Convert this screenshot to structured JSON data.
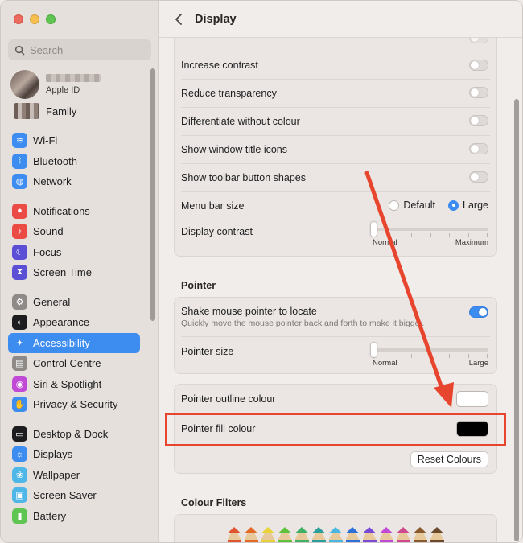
{
  "sidebar": {
    "search_placeholder": "Search",
    "apple_id_label": "Apple ID",
    "family_label": "Family",
    "groups": [
      [
        {
          "label": "Wi-Fi",
          "icon": "wifi-icon",
          "color": "#3d8cf0"
        },
        {
          "label": "Bluetooth",
          "icon": "bluetooth-icon",
          "color": "#3d8cf0"
        },
        {
          "label": "Network",
          "icon": "network-icon",
          "color": "#3d8cf0"
        }
      ],
      [
        {
          "label": "Notifications",
          "icon": "notifications-icon",
          "color": "#ec4b45"
        },
        {
          "label": "Sound",
          "icon": "sound-icon",
          "color": "#ec4b45"
        },
        {
          "label": "Focus",
          "icon": "focus-icon",
          "color": "#5b4fd6"
        },
        {
          "label": "Screen Time",
          "icon": "screen-time-icon",
          "color": "#5b4fd6"
        }
      ],
      [
        {
          "label": "General",
          "icon": "gear-icon",
          "color": "#8e8a88"
        },
        {
          "label": "Appearance",
          "icon": "appearance-icon",
          "color": "#1d1d1f"
        },
        {
          "label": "Accessibility",
          "icon": "accessibility-icon",
          "color": "#3d8cf0",
          "active": true
        },
        {
          "label": "Control Centre",
          "icon": "control-centre-icon",
          "color": "#8e8a88"
        },
        {
          "label": "Siri & Spotlight",
          "icon": "siri-icon",
          "color": "#c04ad6"
        },
        {
          "label": "Privacy & Security",
          "icon": "hand-icon",
          "color": "#3d8cf0"
        }
      ],
      [
        {
          "label": "Desktop & Dock",
          "icon": "dock-icon",
          "color": "#1d1d1f"
        },
        {
          "label": "Displays",
          "icon": "displays-icon",
          "color": "#3d8cf0"
        },
        {
          "label": "Wallpaper",
          "icon": "wallpaper-icon",
          "color": "#4fb6e8"
        },
        {
          "label": "Screen Saver",
          "icon": "screen-saver-icon",
          "color": "#4fb6e8"
        },
        {
          "label": "Battery",
          "icon": "battery-icon",
          "color": "#5ec552"
        }
      ]
    ]
  },
  "header": {
    "title": "Display"
  },
  "display_options": {
    "increase_contrast": {
      "label": "Increase contrast",
      "on": false
    },
    "reduce_transparency": {
      "label": "Reduce transparency",
      "on": false
    },
    "differentiate": {
      "label": "Differentiate without colour",
      "on": false
    },
    "window_title_icons": {
      "label": "Show window title icons",
      "on": false
    },
    "toolbar_shapes": {
      "label": "Show toolbar button shapes",
      "on": false
    },
    "menu_bar_size": {
      "label": "Menu bar size",
      "option_default": "Default",
      "option_large": "Large",
      "selected": "Large"
    },
    "display_contrast": {
      "label": "Display contrast",
      "min_label": "Normal",
      "max_label": "Maximum",
      "value": 0
    }
  },
  "pointer": {
    "section_title": "Pointer",
    "shake": {
      "label": "Shake mouse pointer to locate",
      "description": "Quickly move the mouse pointer back and forth to make it bigger.",
      "on": true
    },
    "size": {
      "label": "Pointer size",
      "min_label": "Normal",
      "max_label": "Large",
      "value": 0
    },
    "outline_colour": {
      "label": "Pointer outline colour",
      "color": "#ffffff"
    },
    "fill_colour": {
      "label": "Pointer fill colour",
      "color": "#000000"
    },
    "reset_label": "Reset Colours"
  },
  "colour_filters": {
    "section_title": "Colour Filters",
    "pencil_colors": [
      "#e0542f",
      "#e36a26",
      "#e8d23a",
      "#5fc23c",
      "#3fb064",
      "#2b9f99",
      "#4bb7e0",
      "#2e6fd8",
      "#7a4ad6",
      "#c04ad6",
      "#d04a8f",
      "#8a5a2f",
      "#6b4a2b"
    ]
  },
  "colors": {
    "accent": "#3d8cf0",
    "highlight": "#e8452f"
  }
}
